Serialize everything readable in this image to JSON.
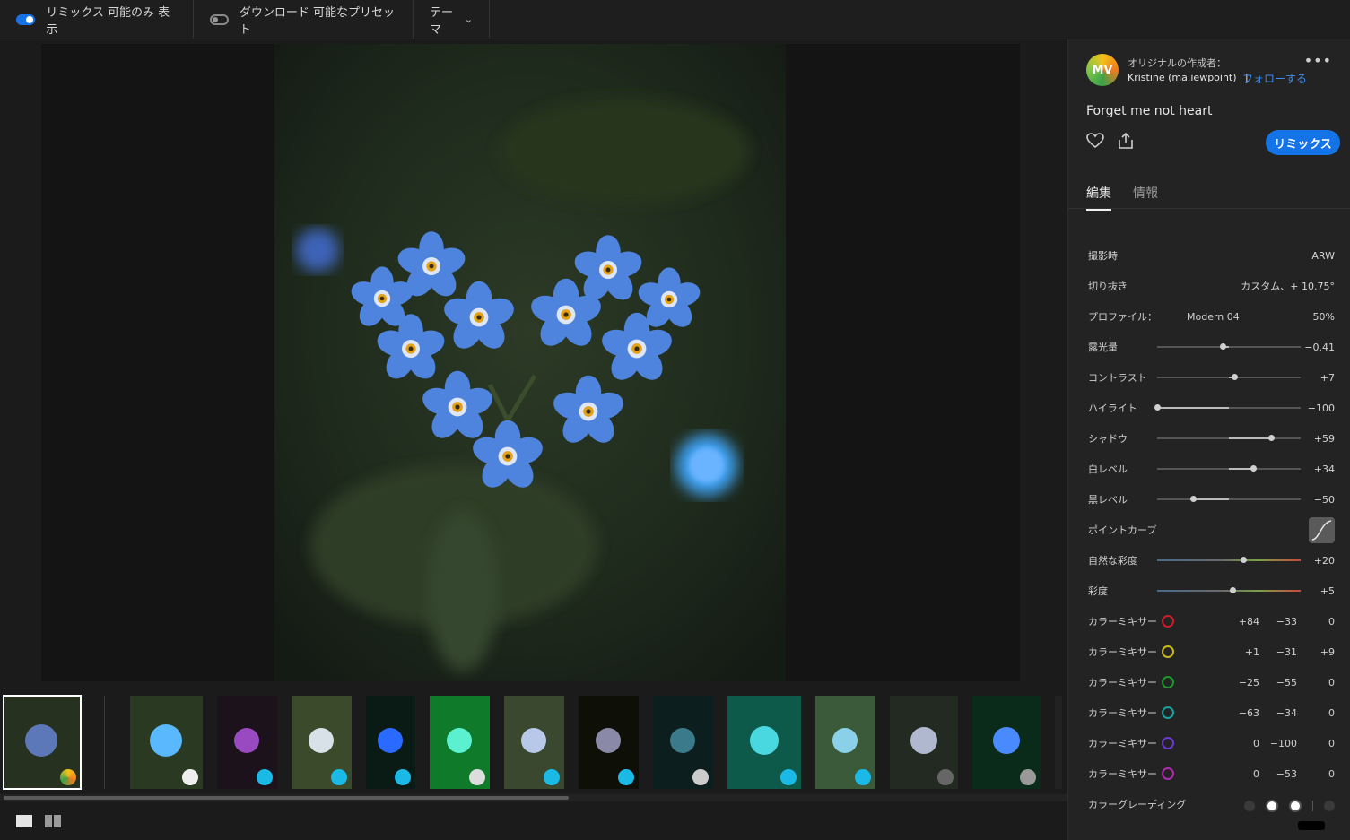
{
  "topbar": {
    "remix_toggle_label": "リミックス 可能のみ 表示",
    "download_toggle_label": "ダウンロード 可能なプリセット",
    "theme_label": "テーマ"
  },
  "author": {
    "avatar_text": "MV",
    "label": "オリジナルの作成者：",
    "name": "Kristīne (ma.iewpoint)",
    "separator": "|",
    "follow": "フォローする"
  },
  "photo_title": "Forget me not heart",
  "remix_button": "リミックス",
  "tabs": [
    "編集",
    "情報"
  ],
  "edits": {
    "shot_label": "撮影時",
    "shot_value": "ARW",
    "crop_label": "切り抜き",
    "crop_value": "カスタム、+ 10.75°",
    "profile_label": "プロファイル：",
    "profile_name": "Modern 04",
    "profile_value": "50%",
    "sliders": [
      {
        "label": "露光量",
        "value": "−0.41",
        "level": -0.41,
        "range": 5
      },
      {
        "label": "コントラスト",
        "value": "+7",
        "level": 7,
        "range": 100
      },
      {
        "label": "ハイライト",
        "value": "−100",
        "level": -100,
        "range": 100
      },
      {
        "label": "シャドウ",
        "value": "+59",
        "level": 59,
        "range": 100
      },
      {
        "label": "白レベル",
        "value": "+34",
        "level": 34,
        "range": 100
      },
      {
        "label": "黒レベル",
        "value": "−50",
        "level": -50,
        "range": 100
      }
    ],
    "curve_label": "ポイントカーブ",
    "vibrance_label": "自然な彩度",
    "vibrance_value": "+20",
    "vibrance_level": 20,
    "saturation_label": "彩度",
    "saturation_value": "+5",
    "saturation_level": 5,
    "mixers": [
      {
        "label": "カラーミキサー",
        "color": "#c8202a",
        "h": "+84",
        "s": "−33",
        "l": "0"
      },
      {
        "label": "カラーミキサー",
        "color": "#c8b81a",
        "h": "+1",
        "s": "−31",
        "l": "+9"
      },
      {
        "label": "カラーミキサー",
        "color": "#1a9a2a",
        "h": "−25",
        "s": "−55",
        "l": "0"
      },
      {
        "label": "カラーミキサー",
        "color": "#1aa0a0",
        "h": "−63",
        "s": "−34",
        "l": "0"
      },
      {
        "label": "カラーミキサー",
        "color": "#6a3ad0",
        "h": "0",
        "s": "−100",
        "l": "0"
      },
      {
        "label": "カラーミキサー",
        "color": "#b02ab0",
        "h": "0",
        "s": "−53",
        "l": "0"
      }
    ],
    "grading_label": "カラーグレーディング"
  },
  "colors": {
    "accent": "#1473e6",
    "link": "#3b8cf0"
  }
}
